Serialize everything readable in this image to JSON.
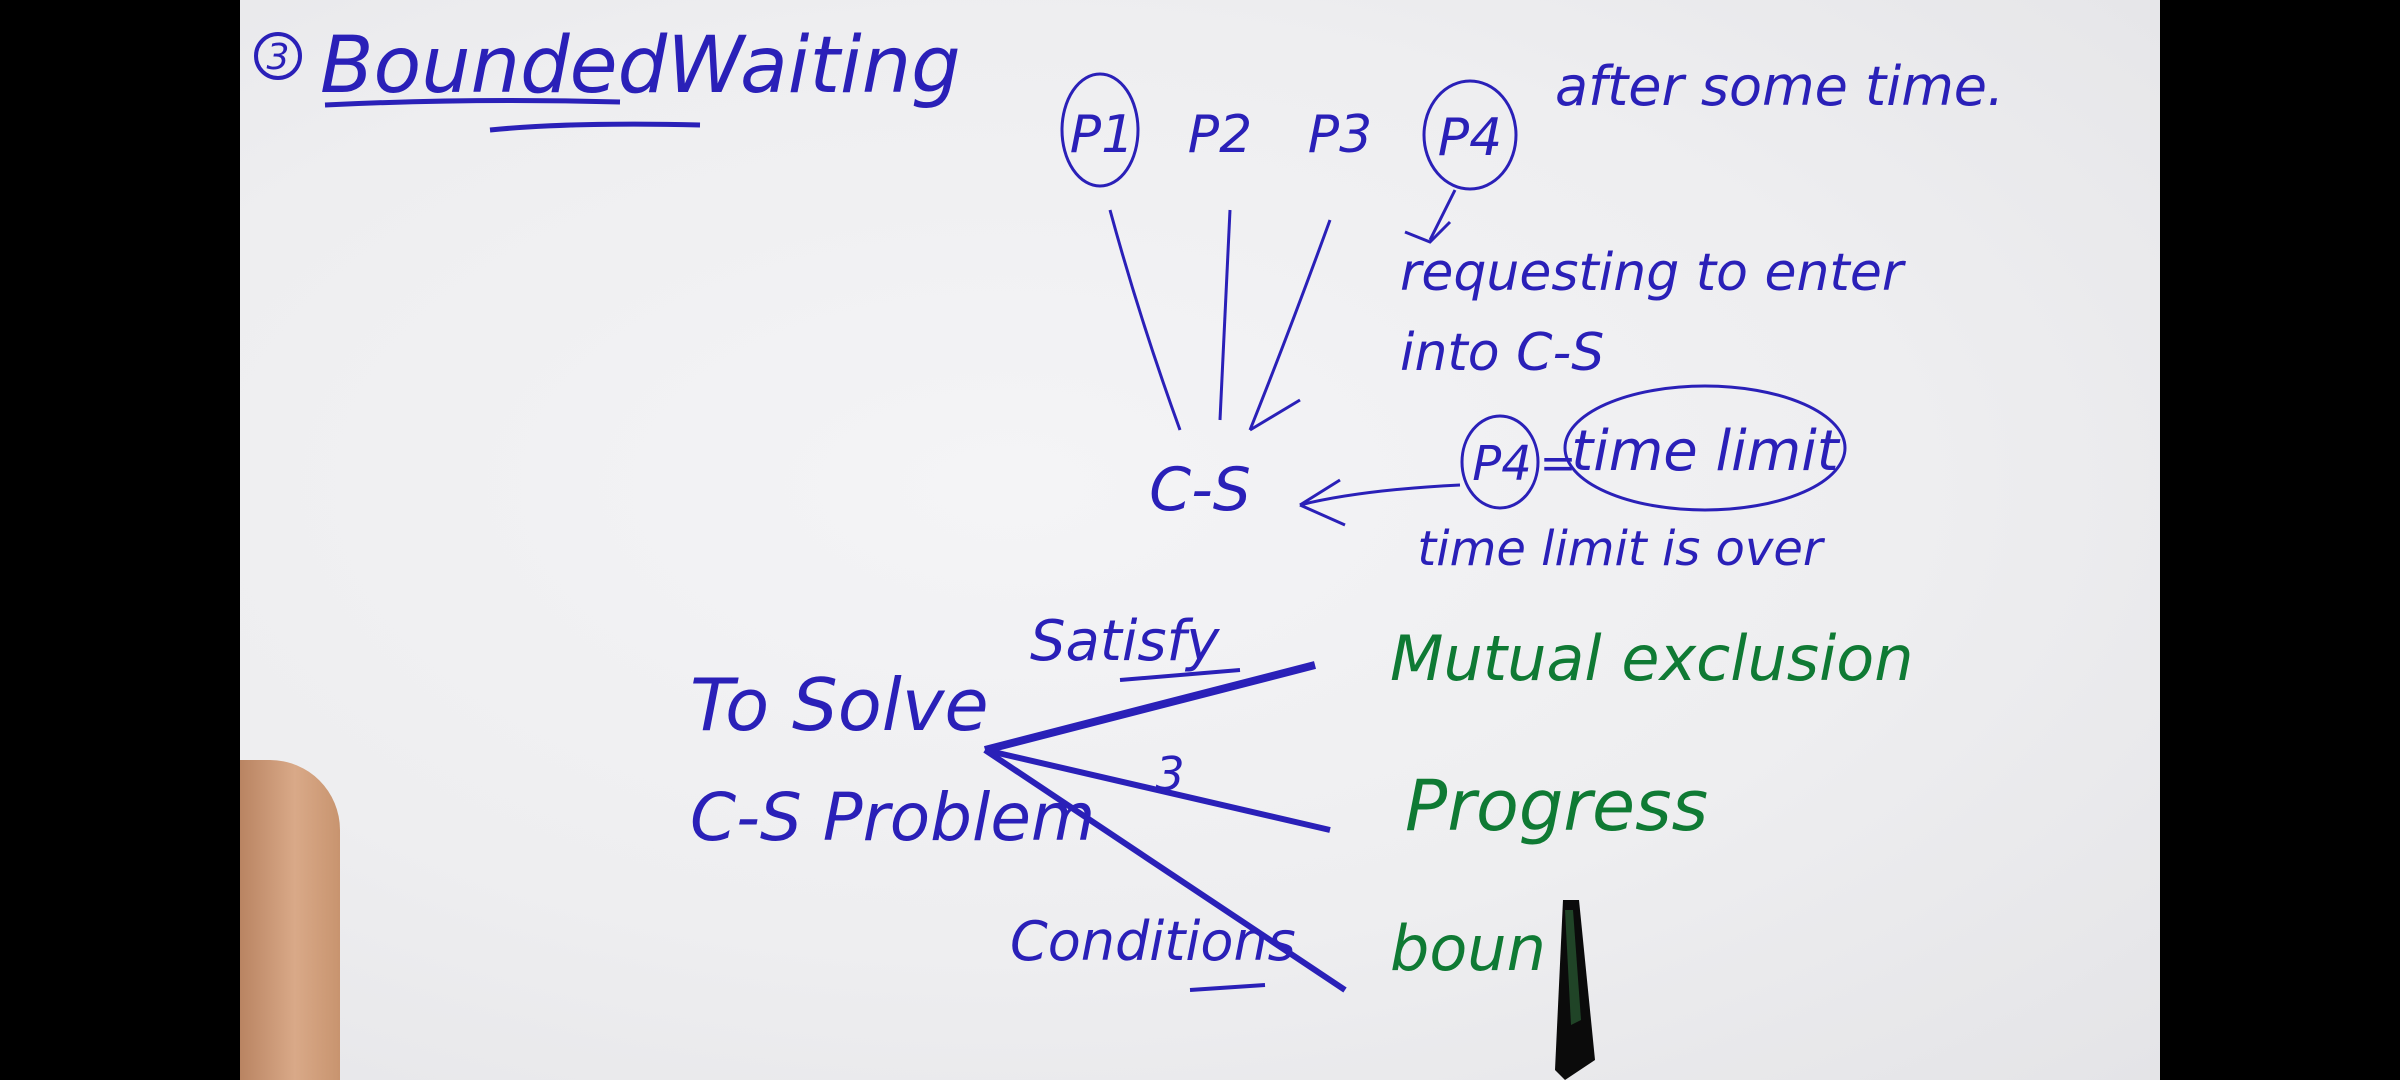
{
  "title": {
    "number": "3",
    "text": "BoundedWaiting"
  },
  "processes": [
    "P1",
    "P2",
    "P3",
    "P4"
  ],
  "note_after": "after some time.",
  "note_requesting_line1": "requesting to enter",
  "note_requesting_line2": "into C-S",
  "cs_label": "C-S",
  "p4_label": "P4",
  "equals": "=",
  "time_limit": "time limit",
  "time_limit_over": "time limit is over",
  "left_block": {
    "line1": "To Solve",
    "line2": "C-S Problem"
  },
  "satisfy": "Satisfy",
  "three": "3",
  "conditions": "Conditions",
  "requirements": [
    "Mutual exclusion",
    "Progress",
    "boun"
  ],
  "colors": {
    "blue_ink": "#2a20b8",
    "green_ink": "#0f7a34",
    "board": "#eeeef0",
    "frame": "#000000"
  }
}
